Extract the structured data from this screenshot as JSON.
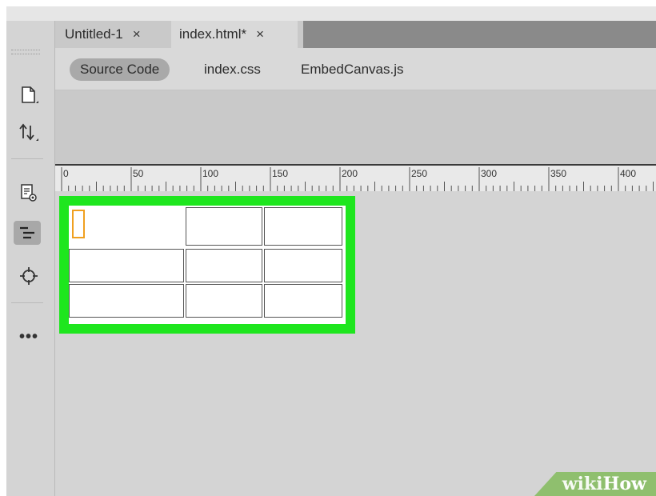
{
  "tabs": [
    {
      "label": "Untitled-1",
      "close": "×",
      "active": false
    },
    {
      "label": "index.html*",
      "close": "×",
      "active": true
    }
  ],
  "files": [
    {
      "label": "Source Code",
      "active": true
    },
    {
      "label": "index.css",
      "active": false
    },
    {
      "label": "EmbedCanvas.js",
      "active": false
    }
  ],
  "sidebar": {
    "icons": [
      "file-icon",
      "transfer-icon",
      "live-view-icon",
      "dom-panel-icon",
      "target-icon",
      "more-icon"
    ],
    "more_label": "•••"
  },
  "ruler": {
    "labels": [
      "0",
      "50",
      "100",
      "150",
      "200",
      "250",
      "300",
      "350",
      "400"
    ]
  },
  "canvas": {
    "table_rows": 3,
    "table_cols": 3,
    "highlight_color": "#1ee61e",
    "cursor_color": "#f0a020"
  },
  "watermark": {
    "part1": "wiki",
    "part2": "How"
  }
}
